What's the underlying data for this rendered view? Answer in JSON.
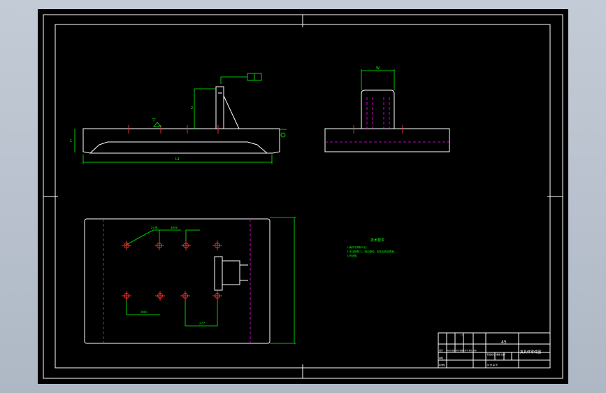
{
  "drawing": {
    "front_view": {
      "dim_length": "L1",
      "dim_height": "1",
      "dim_rib": "2",
      "datum_symbol": "▽",
      "tolerance_frame": "[  ]"
    },
    "side_view": {
      "dim_width": "W"
    },
    "plan_view": {
      "dim_labels": [
        "2×Φ",
        "3mm",
        "2Mm",
        "2-5°"
      ]
    },
    "notes": {
      "heading": "技术要求",
      "lines": [
        "1.铸件不得有气孔。",
        "2.未注倒角C1，锐边倒钝，去除毛刺及表面。",
        "3.热处理。"
      ]
    },
    "title_block": {
      "material": "45",
      "drawing_name": "夹具体零件图",
      "scale_row": "阶段标记 重量 比例",
      "sheet_row": "共 张 第 张",
      "designer_label": "设计",
      "check_label": "审核",
      "std_label": "标准化",
      "standard": "标记 处数 分区 更改文件号 签名 日期"
    }
  }
}
